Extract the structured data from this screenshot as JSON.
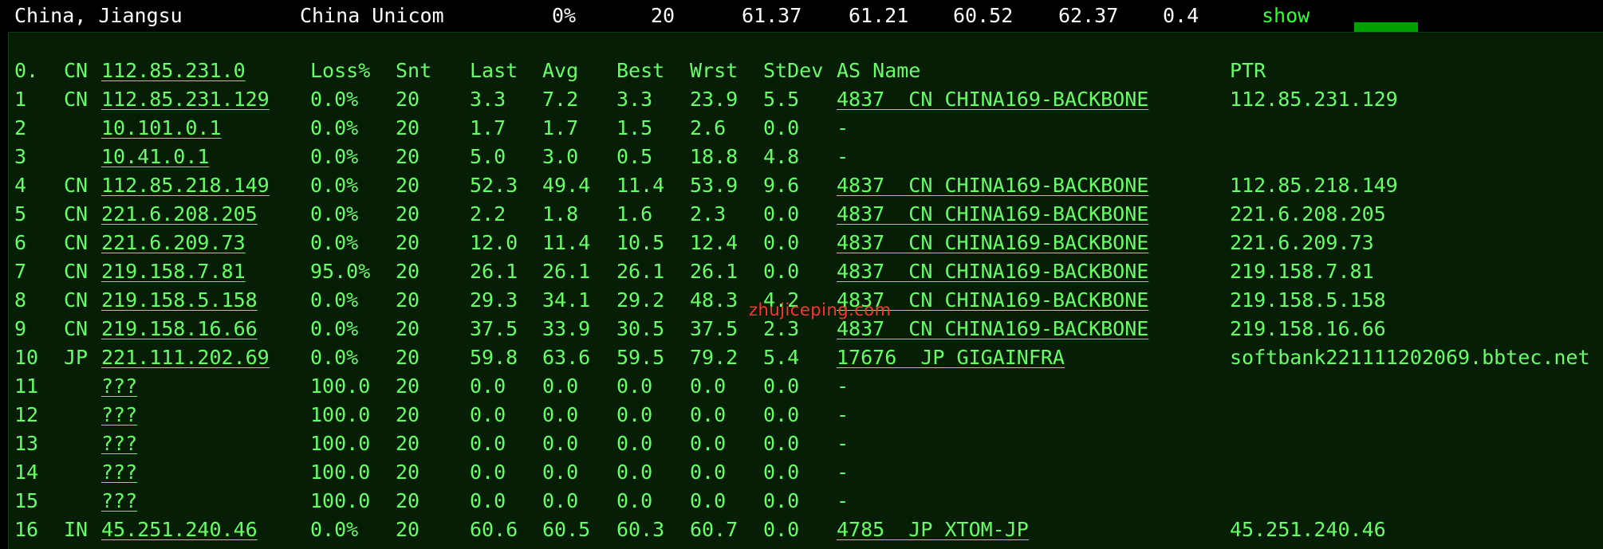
{
  "summary": {
    "location": "China, Jiangsu",
    "isp": "China Unicom",
    "loss": "0%",
    "sent": "20",
    "last": "61.37",
    "avg": "61.21",
    "best": "60.52",
    "worst": "62.37",
    "stdev": "0.4",
    "action": "show"
  },
  "headers": [
    "0.",
    "CN",
    "112.85.231.0",
    "Loss%",
    "Snt",
    "Last",
    "Avg",
    "Best",
    "Wrst",
    "StDev",
    "AS Name",
    "PTR"
  ],
  "hops": [
    {
      "n": "1",
      "cc": "CN",
      "ip": "112.85.231.129",
      "loss": "0.0%",
      "snt": "20",
      "last": "3.3",
      "avg": "7.2",
      "best": "3.3",
      "wrst": "23.9",
      "stdev": "5.5",
      "as": "4837  CN CHINA169-BACKBONE",
      "ptr": "112.85.231.129"
    },
    {
      "n": "2",
      "cc": "",
      "ip": "10.101.0.1",
      "loss": "0.0%",
      "snt": "20",
      "last": "1.7",
      "avg": "1.7",
      "best": "1.5",
      "wrst": "2.6",
      "stdev": "0.0",
      "as": "-",
      "ptr": ""
    },
    {
      "n": "3",
      "cc": "",
      "ip": "10.41.0.1",
      "loss": "0.0%",
      "snt": "20",
      "last": "5.0",
      "avg": "3.0",
      "best": "0.5",
      "wrst": "18.8",
      "stdev": "4.8",
      "as": "-",
      "ptr": ""
    },
    {
      "n": "4",
      "cc": "CN",
      "ip": "112.85.218.149",
      "loss": "0.0%",
      "snt": "20",
      "last": "52.3",
      "avg": "49.4",
      "best": "11.4",
      "wrst": "53.9",
      "stdev": "9.6",
      "as": "4837  CN CHINA169-BACKBONE",
      "ptr": "112.85.218.149"
    },
    {
      "n": "5",
      "cc": "CN",
      "ip": "221.6.208.205",
      "loss": "0.0%",
      "snt": "20",
      "last": "2.2",
      "avg": "1.8",
      "best": "1.6",
      "wrst": "2.3",
      "stdev": "0.0",
      "as": "4837  CN CHINA169-BACKBONE",
      "ptr": "221.6.208.205"
    },
    {
      "n": "6",
      "cc": "CN",
      "ip": "221.6.209.73",
      "loss": "0.0%",
      "snt": "20",
      "last": "12.0",
      "avg": "11.4",
      "best": "10.5",
      "wrst": "12.4",
      "stdev": "0.0",
      "as": "4837  CN CHINA169-BACKBONE",
      "ptr": "221.6.209.73"
    },
    {
      "n": "7",
      "cc": "CN",
      "ip": "219.158.7.81",
      "loss": "95.0%",
      "snt": "20",
      "last": "26.1",
      "avg": "26.1",
      "best": "26.1",
      "wrst": "26.1",
      "stdev": "0.0",
      "as": "4837  CN CHINA169-BACKBONE",
      "ptr": "219.158.7.81"
    },
    {
      "n": "8",
      "cc": "CN",
      "ip": "219.158.5.158",
      "loss": "0.0%",
      "snt": "20",
      "last": "29.3",
      "avg": "34.1",
      "best": "29.2",
      "wrst": "48.3",
      "stdev": "4.2",
      "as": "4837  CN CHINA169-BACKBONE",
      "ptr": "219.158.5.158"
    },
    {
      "n": "9",
      "cc": "CN",
      "ip": "219.158.16.66",
      "loss": "0.0%",
      "snt": "20",
      "last": "37.5",
      "avg": "33.9",
      "best": "30.5",
      "wrst": "37.5",
      "stdev": "2.3",
      "as": "4837  CN CHINA169-BACKBONE",
      "ptr": "219.158.16.66"
    },
    {
      "n": "10",
      "cc": "JP",
      "ip": "221.111.202.69",
      "loss": "0.0%",
      "snt": "20",
      "last": "59.8",
      "avg": "63.6",
      "best": "59.5",
      "wrst": "79.2",
      "stdev": "5.4",
      "as": "17676  JP GIGAINFRA",
      "ptr": "softbank221111202069.bbtec.net"
    },
    {
      "n": "11",
      "cc": "",
      "ip": "???",
      "loss": "100.0",
      "snt": "20",
      "last": "0.0",
      "avg": "0.0",
      "best": "0.0",
      "wrst": "0.0",
      "stdev": "0.0",
      "as": "-",
      "ptr": ""
    },
    {
      "n": "12",
      "cc": "",
      "ip": "???",
      "loss": "100.0",
      "snt": "20",
      "last": "0.0",
      "avg": "0.0",
      "best": "0.0",
      "wrst": "0.0",
      "stdev": "0.0",
      "as": "-",
      "ptr": ""
    },
    {
      "n": "13",
      "cc": "",
      "ip": "???",
      "loss": "100.0",
      "snt": "20",
      "last": "0.0",
      "avg": "0.0",
      "best": "0.0",
      "wrst": "0.0",
      "stdev": "0.0",
      "as": "-",
      "ptr": ""
    },
    {
      "n": "14",
      "cc": "",
      "ip": "???",
      "loss": "100.0",
      "snt": "20",
      "last": "0.0",
      "avg": "0.0",
      "best": "0.0",
      "wrst": "0.0",
      "stdev": "0.0",
      "as": "-",
      "ptr": ""
    },
    {
      "n": "15",
      "cc": "",
      "ip": "???",
      "loss": "100.0",
      "snt": "20",
      "last": "0.0",
      "avg": "0.0",
      "best": "0.0",
      "wrst": "0.0",
      "stdev": "0.0",
      "as": "-",
      "ptr": ""
    },
    {
      "n": "16",
      "cc": "IN",
      "ip": "45.251.240.46",
      "loss": "0.0%",
      "snt": "20",
      "last": "60.6",
      "avg": "60.5",
      "best": "60.3",
      "wrst": "60.7",
      "stdev": "0.0",
      "as": "4785  JP XTOM-JP",
      "ptr": "45.251.240.46"
    }
  ],
  "watermark": "zhujiceping.com",
  "colors": {
    "background": "#000000",
    "panel": "#061d06",
    "text": "#66ff66",
    "summary_text": "#ffffff",
    "bar": "#00a000",
    "watermark": "#ff3333"
  }
}
